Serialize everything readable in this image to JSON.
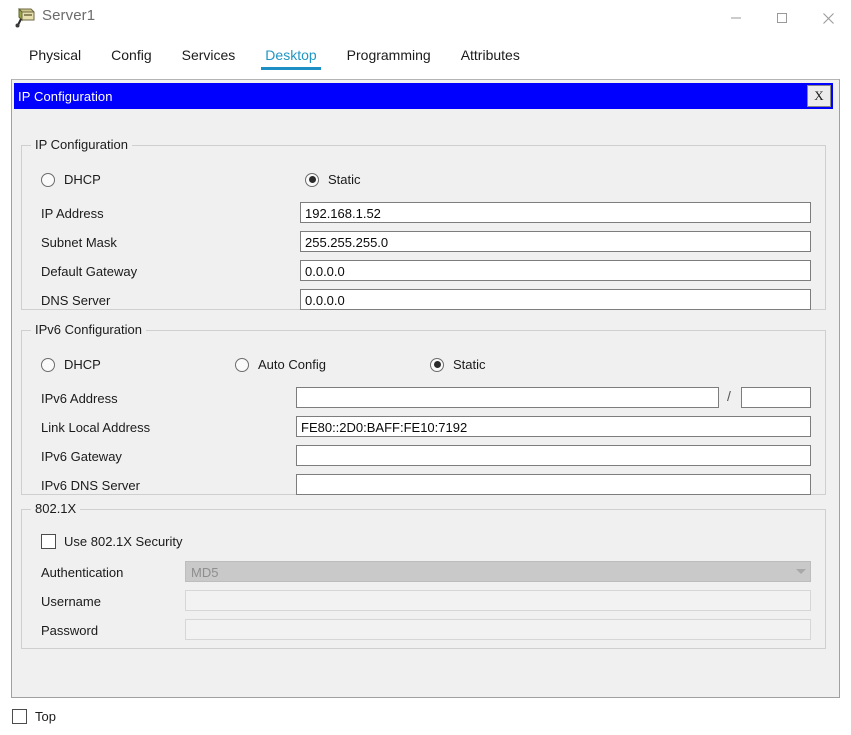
{
  "window": {
    "title": "Server1",
    "icon": "server-device-icon",
    "controls": {
      "minimize": "minimize-icon",
      "maximize": "maximize-icon",
      "close": "close-icon"
    }
  },
  "tabs": [
    {
      "label": "Physical",
      "active": false
    },
    {
      "label": "Config",
      "active": false
    },
    {
      "label": "Services",
      "active": false
    },
    {
      "label": "Desktop",
      "active": true
    },
    {
      "label": "Programming",
      "active": false
    },
    {
      "label": "Attributes",
      "active": false
    }
  ],
  "active_tab_color": "#2196c4",
  "ip_configuration_window": {
    "title": "IP Configuration",
    "close_label": "X",
    "titlebar_color": "#0000ff"
  },
  "ipv4": {
    "legend": "IP Configuration",
    "mode_options": [
      {
        "label": "DHCP",
        "selected": false
      },
      {
        "label": "Static",
        "selected": true
      }
    ],
    "fields": [
      {
        "label": "IP Address",
        "value": "192.168.1.52",
        "disabled": false
      },
      {
        "label": "Subnet Mask",
        "value": "255.255.255.0",
        "disabled": false
      },
      {
        "label": "Default Gateway",
        "value": "0.0.0.0",
        "disabled": false
      },
      {
        "label": "DNS Server",
        "value": "0.0.0.0",
        "disabled": false
      }
    ]
  },
  "ipv6": {
    "legend": "IPv6 Configuration",
    "mode_options": [
      {
        "label": "DHCP",
        "selected": false
      },
      {
        "label": "Auto Config",
        "selected": false
      },
      {
        "label": "Static",
        "selected": true
      }
    ],
    "address_label": "IPv6 Address",
    "address_value": "",
    "prefix_separator": "/",
    "prefix_value": "",
    "fields": [
      {
        "label": "Link Local Address",
        "value": "FE80::2D0:BAFF:FE10:7192",
        "disabled": false
      },
      {
        "label": "IPv6 Gateway",
        "value": "",
        "disabled": false
      },
      {
        "label": "IPv6 DNS Server",
        "value": "",
        "disabled": false
      }
    ]
  },
  "dot1x": {
    "legend": "802.1X",
    "use_security": {
      "label": "Use 802.1X Security",
      "checked": false
    },
    "authentication": {
      "label": "Authentication",
      "value": "MD5",
      "disabled": true
    },
    "username": {
      "label": "Username",
      "value": "",
      "disabled": true
    },
    "password": {
      "label": "Password",
      "value": "",
      "disabled": true
    }
  },
  "footer": {
    "top_checkbox": {
      "label": "Top",
      "checked": false
    }
  }
}
